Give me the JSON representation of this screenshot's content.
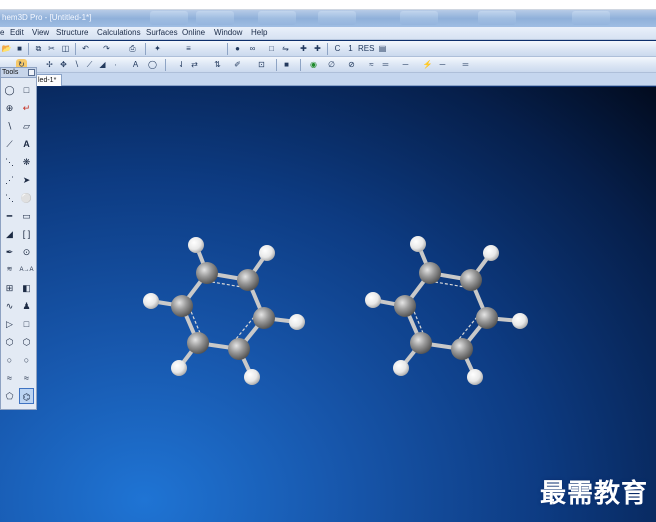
{
  "window": {
    "title": "hem3D Pro - [Untitled-1*]"
  },
  "menu": [
    "e",
    "Edit",
    "View",
    "Structure",
    "Calculations",
    "Surfaces",
    "Online",
    "Window",
    "Help"
  ],
  "toolbar1": [
    "open",
    "save",
    "copy",
    "cut",
    "paste",
    "undo",
    "redo",
    "print",
    "C",
    "1",
    "RES"
  ],
  "toolbar2": [
    "move",
    "rotate",
    "select",
    "A",
    "erase"
  ],
  "tab": {
    "label": "led-1*"
  },
  "tools_palette": {
    "title": "Tools",
    "items": [
      "lasso",
      "select-rect",
      "trackball",
      "rotate",
      "line",
      "eraser",
      "bond",
      "A",
      "dashed-bond",
      "lone-pair",
      "wedge",
      "arrow",
      "hash",
      "dummy",
      "thick-bond",
      "rectangle",
      "bold-bond",
      "bracket",
      "pen",
      "target",
      "double",
      "A-arrow",
      "table",
      "orbital",
      "wave",
      "person",
      "triangle",
      "square",
      "hexagon",
      "hexagon-2",
      "circle",
      "circle-2",
      "ribbon",
      "ribbon-2",
      "pentagon",
      "benzene"
    ],
    "selected": "benzene"
  },
  "watermark": "最需教育",
  "colors": {
    "canvas_top": "#061f4b",
    "canvas_bottom": "#1f74d4",
    "carbon": "#8e8e8e",
    "hydrogen": "#ffffff"
  }
}
